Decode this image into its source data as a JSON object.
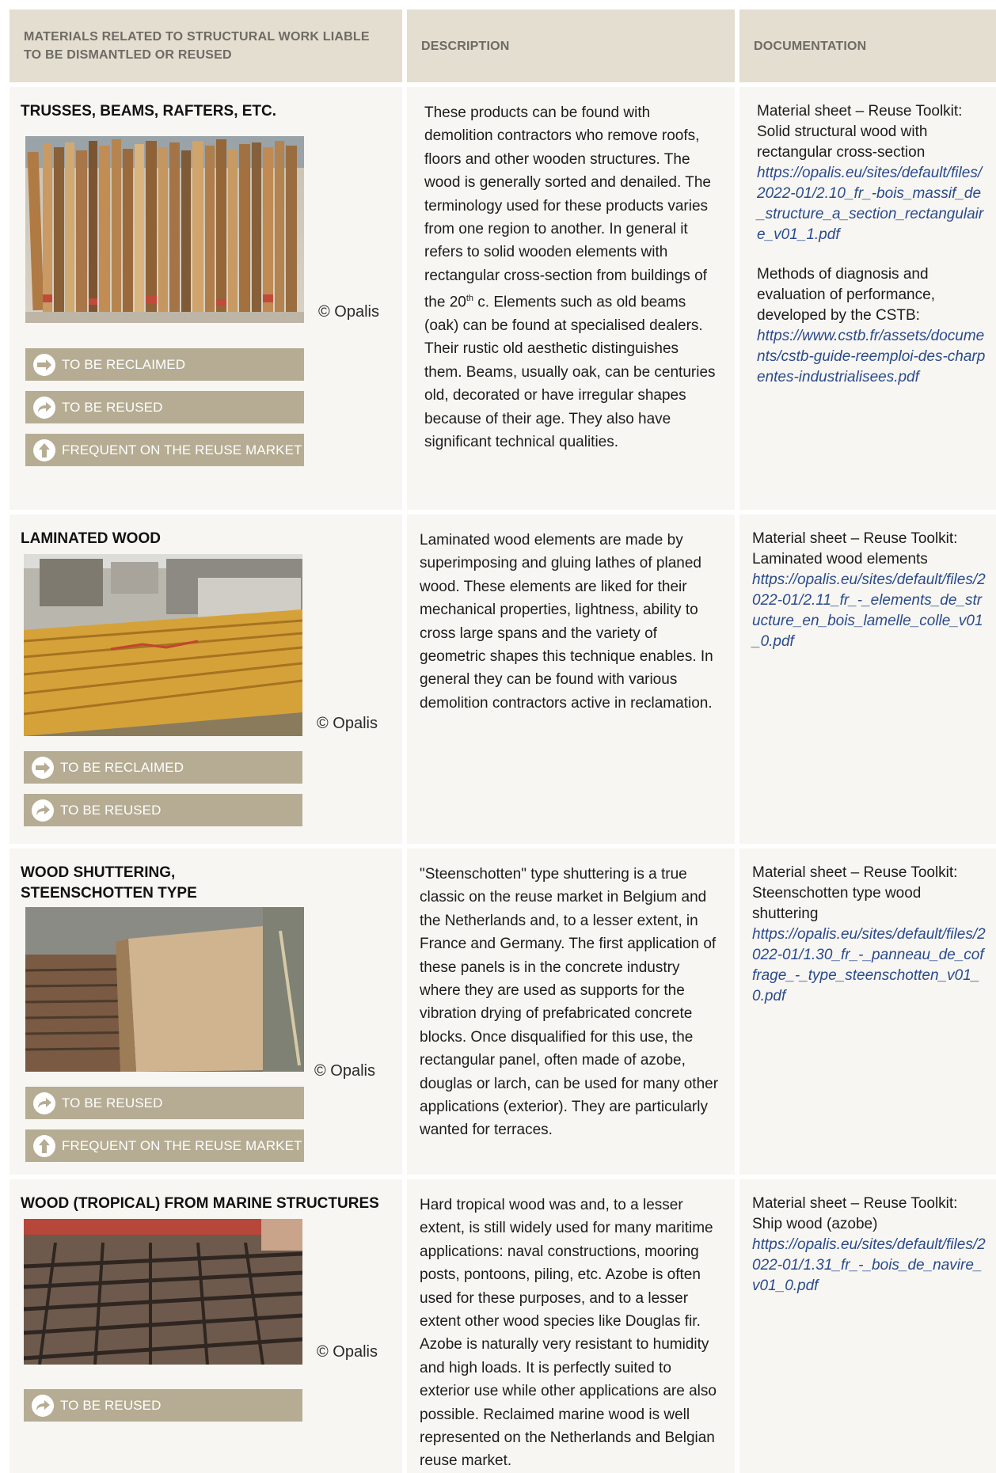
{
  "headers": {
    "materials": "MATERIALS RELATED TO STRUCTURAL WORK LIABLE TO BE DISMANTLED OR REUSED",
    "description": "DESCRIPTION",
    "documentation": "DOCUMENTATION"
  },
  "credit": "© Opalis",
  "tag_colors": {
    "background": "#b5ac93",
    "icon": "#ffffff"
  },
  "rows": [
    {
      "title": "TRUSSES, BEAMS, RAFTERS, ETC.",
      "tags": [
        {
          "label": "TO BE RECLAIMED",
          "icon": "arrow-right-icon"
        },
        {
          "label": "TO BE REUSED",
          "icon": "curved-arrow-right-icon"
        },
        {
          "label": "FREQUENT ON THE REUSE MARKET",
          "icon": "arrow-up-icon"
        }
      ],
      "description_parts": [
        "These products can be found with demolition contractors who remove roofs, floors and other wooden structures. The wood is generally sorted and denailed. The terminology used for these products varies from one region to another. In general it refers to solid wooden elements with rectangular cross-section from buildings of the 20",
        "th",
        " c. Elements such as old beams (oak) can be found at specialised dealers. Their rustic old aesthetic distinguishes them. Beams, usually oak, can be centuries old, decorated or have irregular shapes because of their age. They also have significant technical qualities."
      ],
      "docs": [
        {
          "text": "Material sheet – Reuse Toolkit: Solid structural wood with rectangular cross-section",
          "link": "https://opalis.eu/sites/default/files/2022-01/2.10_fr_-bois_massif_de_structure_a_section_rectangulaire_v01_1.pdf"
        },
        {
          "text": "Methods of diagnosis and evaluation of performance, developed by the CSTB:",
          "link": "https://www.cstb.fr/assets/documents/cstb-guide-reemploi-des-charpentes-industrialisees.pdf"
        }
      ]
    },
    {
      "title": "LAMINATED WOOD",
      "tags": [
        {
          "label": "TO BE RECLAIMED",
          "icon": "arrow-right-icon"
        },
        {
          "label": "TO BE REUSED",
          "icon": "curved-arrow-right-icon"
        }
      ],
      "description": "Laminated wood elements are made by superimposing and gluing lathes of planed wood. These elements are liked for their mechanical properties, lightness, ability to cross large spans and the variety of geometric shapes this technique enables. In general they can be found with various demolition contractors active in reclamation.",
      "docs": [
        {
          "text": "Material sheet – Reuse Toolkit: Laminated wood elements",
          "link": "https://opalis.eu/sites/default/files/2022-01/2.11_fr_-_elements_de_structure_en_bois_lamelle_colle_v01_0.pdf"
        }
      ]
    },
    {
      "title": "WOOD SHUTTERING,\n STEENSCHOTTEN TYPE",
      "tags": [
        {
          "label": "TO BE REUSED",
          "icon": "curved-arrow-right-icon"
        },
        {
          "label": "FREQUENT ON THE REUSE MARKET",
          "icon": "arrow-up-icon"
        }
      ],
      "description": "\"Steenschotten\" type shuttering is a true classic on the reuse market in Belgium and the Netherlands and, to a lesser extent, in France and Germany. The first application of these panels is in the concrete industry where they are used as supports for the vibration drying of prefabricated concrete blocks. Once disqualified for this use, the rectangular panel, often made of azobe, douglas or larch, can be used for many other applications (exterior). They are particularly wanted for terraces.",
      "docs": [
        {
          "text": "Material sheet – Reuse Toolkit: Steenschotten type wood shuttering",
          "link": "https://opalis.eu/sites/default/files/2022-01/1.30_fr_-_panneau_de_coffrage_-_type_steenschotten_v01_0.pdf"
        }
      ]
    },
    {
      "title": "WOOD (TROPICAL) FROM MARINE STRUCTURES",
      "tags": [
        {
          "label": "TO BE REUSED",
          "icon": "curved-arrow-right-icon"
        }
      ],
      "description": "Hard tropical wood was and, to a lesser extent, is still widely used for many maritime applications: naval constructions, mooring posts, pontoons, piling, etc. Azobe is often used for these purposes, and to a lesser extent other wood species like Douglas fir. Azobe is naturally very resistant to humidity and high loads. It is perfectly suited to exterior use while other applications are also possible. Reclaimed marine wood is well represented on the Netherlands and Belgian reuse market.",
      "docs": [
        {
          "text": "Material sheet – Reuse Toolkit: Ship wood (azobe)",
          "link": "https://opalis.eu/sites/default/files/2022-01/1.31_fr_-_bois_de_navire_v01_0.pdf"
        }
      ]
    }
  ]
}
